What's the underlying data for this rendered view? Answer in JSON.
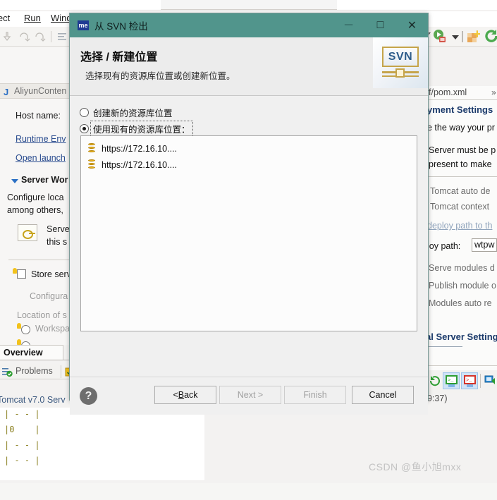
{
  "ide": {
    "menu": [
      {
        "label": "ject",
        "accel": ""
      },
      {
        "label": "Run",
        "accel": "R"
      },
      {
        "label": "Wind",
        "accel": "W"
      }
    ],
    "left_panel": {
      "tab_label": "AliyunConten",
      "host_name_label": "Host name:",
      "runtime_env_link": "Runtime Env",
      "open_launch_link": "Open launch",
      "server_workspace_heading": "Server Wor",
      "configure_line1": "Configure loca",
      "configure_line2": "among others,",
      "server_line1": "Serve",
      "server_line2": "this s",
      "store_serv_label": "Store serv",
      "configura_label": "Configura",
      "location_of_label": "Location of s",
      "workspace_label": "Workspa",
      "overview_tab": "Overview",
      "problems_tab": "Problems",
      "console_title": "Tomcat v7.0 Serv",
      "console_lines": [
        "| - - |",
        "|0    |",
        "| - - |",
        "| - - |"
      ]
    },
    "right_panel": {
      "tab_label": "f/pom.xml",
      "heading": "yment Settings",
      "desc_line": "e the way your pr",
      "note_line1": "Server must be p",
      "note_line2": "present to make",
      "bullet1": "Tomcat auto de",
      "bullet2": "Tomcat context",
      "deploy_link": "deploy path to th",
      "deploy_path_label": "loy path:",
      "deploy_path_value": "wtpw",
      "serve_modules": "Serve modules d",
      "publish_module": "Publish module o",
      "modules_auto": "Modules auto re",
      "server_settings_heading": "al Server Setting",
      "timestamp": "9:37)"
    },
    "watermark": "CSDN @鱼小旭mxx"
  },
  "dialog": {
    "titlebar": {
      "app_badge": "me",
      "title": "从 SVN 检出",
      "minimize": "─",
      "maximize": "□",
      "close": "✕"
    },
    "header": {
      "heading": "选择 / 新建位置",
      "subheading": "选择现有的资源库位置或创建新位置。",
      "logo_text": "SVN"
    },
    "body": {
      "radio_new_label": "创建新的资源库位置",
      "radio_existing_label": "使用现有的资源库位置：",
      "selected_option": "existing",
      "repositories": [
        "https://172.16.10....",
        "https://172.16.10...."
      ]
    },
    "footer": {
      "help_glyph": "?",
      "back_pre": "< ",
      "back_accel": "B",
      "back_post": "ack",
      "next_label": "Next >",
      "finish_label": "Finish",
      "cancel_label": "Cancel",
      "back_enabled": true,
      "next_enabled": false,
      "finish_enabled": false,
      "cancel_enabled": true
    }
  },
  "colors": {
    "titlebar": "#51958c",
    "dialog_bg": "#f0f0f0",
    "accent_link": "#2a4c8f",
    "repo_icon": "#e8b21d"
  }
}
